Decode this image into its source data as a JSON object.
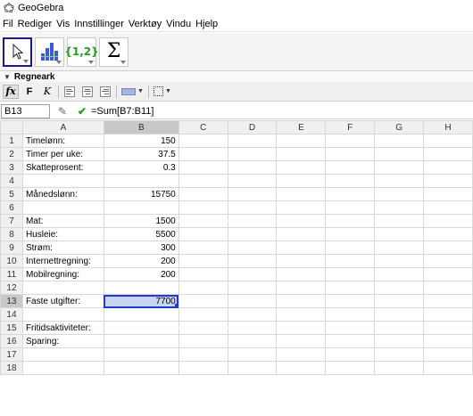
{
  "window": {
    "title": "GeoGebra"
  },
  "menu": [
    "Fil",
    "Rediger",
    "Vis",
    "Innstillinger",
    "Verktøy",
    "Vindu",
    "Hjelp"
  ],
  "toolbar": {
    "tools": [
      {
        "name": "move-tool",
        "icon": "arrow-cursor-icon",
        "selected": true
      },
      {
        "name": "two-variable-tool",
        "icon": "bar-chart-icon",
        "selected": false
      },
      {
        "name": "create-list-tool",
        "label": "{1,2}",
        "selected": false
      },
      {
        "name": "sum-tool",
        "label": "Σ",
        "selected": false
      }
    ]
  },
  "panel": {
    "title": "Regneark"
  },
  "formatbar": {
    "bold": "F",
    "italic": "K",
    "swatch_color": "#aab4e0"
  },
  "input": {
    "cell_ref": "B13",
    "formula": "=Sum[B7:B11]"
  },
  "sheet": {
    "columns": [
      "A",
      "B",
      "C",
      "D",
      "E",
      "F",
      "G",
      "H"
    ],
    "active_column": "B",
    "active_row": "13",
    "rows": [
      {
        "n": "1",
        "a": "Timelønn:",
        "b": "150"
      },
      {
        "n": "2",
        "a": "Timer per uke:",
        "b": "37.5"
      },
      {
        "n": "3",
        "a": "Skatteprosent:",
        "b": "0.3"
      },
      {
        "n": "4",
        "a": "",
        "b": ""
      },
      {
        "n": "5",
        "a": "Månedslønn:",
        "b": "15750"
      },
      {
        "n": "6",
        "a": "",
        "b": ""
      },
      {
        "n": "7",
        "a": "Mat:",
        "b": "1500"
      },
      {
        "n": "8",
        "a": "Husleie:",
        "b": "5500"
      },
      {
        "n": "9",
        "a": "Strøm:",
        "b": "300"
      },
      {
        "n": "10",
        "a": "Internettregning:",
        "b": "200"
      },
      {
        "n": "11",
        "a": "Mobilregning:",
        "b": "200"
      },
      {
        "n": "12",
        "a": "",
        "b": ""
      },
      {
        "n": "13",
        "a": "Faste utgifter:",
        "b": "7700"
      },
      {
        "n": "14",
        "a": "",
        "b": ""
      },
      {
        "n": "15",
        "a": "Fritidsaktiviteter:",
        "b": ""
      },
      {
        "n": "16",
        "a": "Sparing:",
        "b": ""
      },
      {
        "n": "17",
        "a": "",
        "b": ""
      },
      {
        "n": "18",
        "a": "",
        "b": ""
      }
    ]
  }
}
